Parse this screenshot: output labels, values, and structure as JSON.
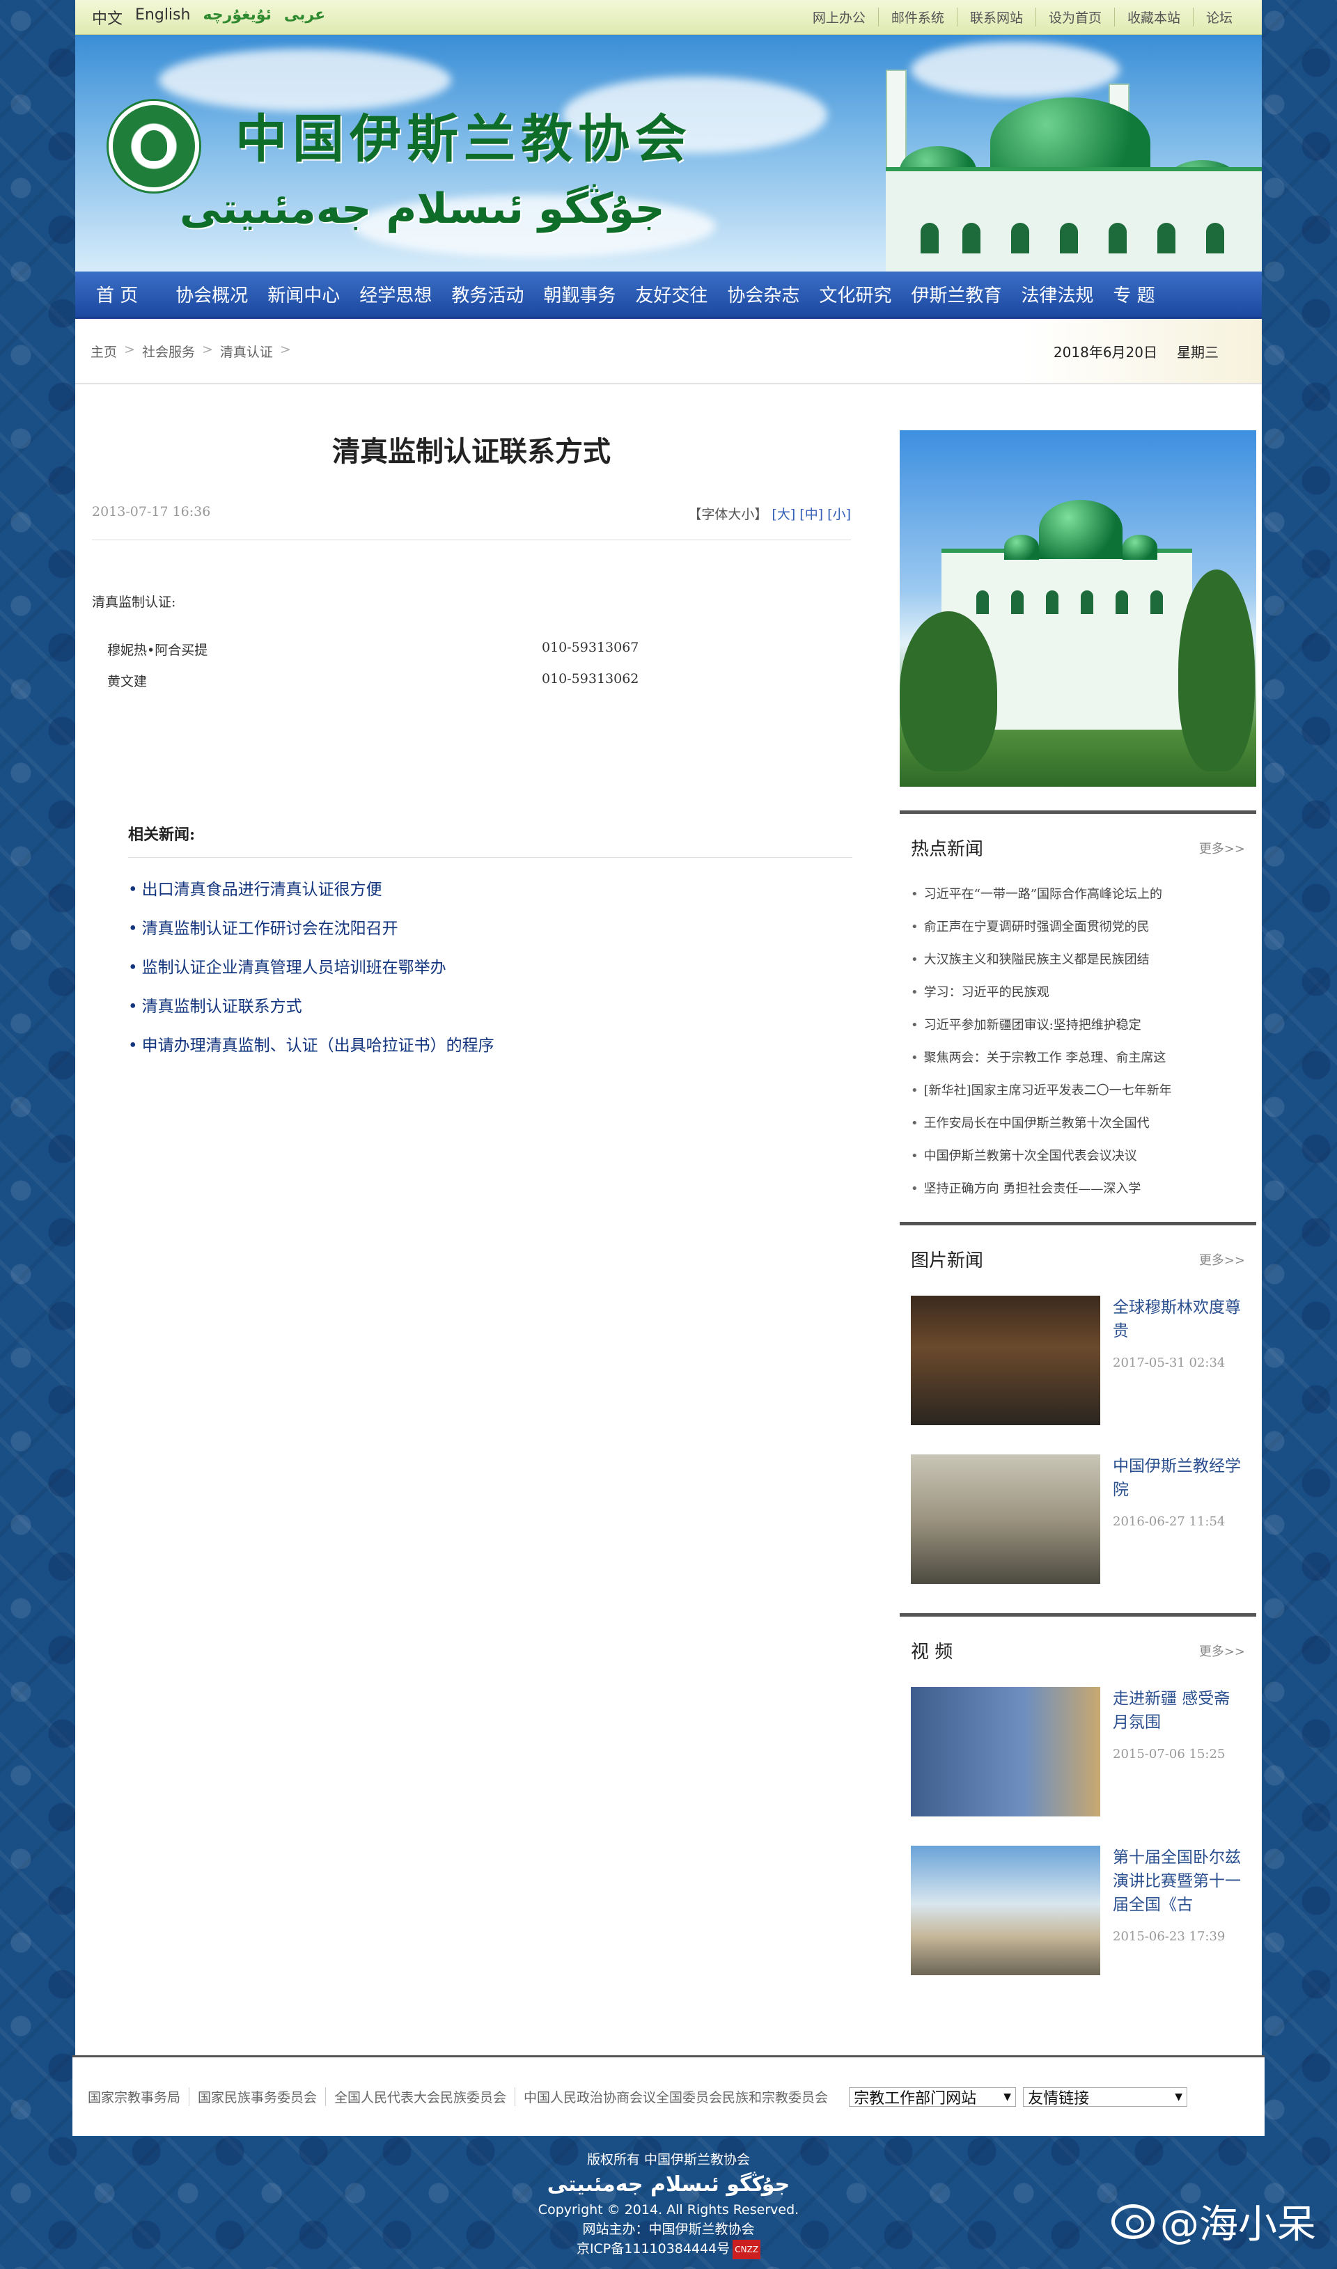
{
  "topbar": {
    "languages": [
      "中文",
      "English",
      "ئۇيغۇرچە",
      "عربی"
    ],
    "links": [
      "网上办公",
      "邮件系统",
      "联系网站",
      "设为首页",
      "收藏本站",
      "论坛"
    ]
  },
  "banner": {
    "site_name_zh": "中国伊斯兰教协会",
    "site_name_ug": "جۇڭگو ئىسلام جەمئىيتى"
  },
  "nav": {
    "items": [
      "首 页",
      "协会概况",
      "新闻中心",
      "经学思想",
      "教务活动",
      "朝觐事务",
      "友好交往",
      "协会杂志",
      "文化研究",
      "伊斯兰教育",
      "法律法规",
      "专 题"
    ]
  },
  "breadcrumb": {
    "items": [
      "主页",
      "社会服务",
      "清真认证"
    ],
    "date": "2018年6月20日",
    "weekday": "星期三"
  },
  "article": {
    "title": "清真监制认证联系方式",
    "datetime": "2013-07-17 16:36",
    "font_size_label": "【字体大小】",
    "font_sizes": [
      "[大]",
      "[中]",
      "[小]"
    ],
    "section_label": "清真监制认证:",
    "contacts": [
      {
        "name": "穆妮热•阿合买提",
        "phone": "010-59313067"
      },
      {
        "name": "黄文建",
        "phone": "010-59313062"
      }
    ]
  },
  "related": {
    "heading": "相关新闻:",
    "items": [
      "出口清真食品进行清真认证很方便",
      "清真监制认证工作研讨会在沈阳召开",
      "监制认证企业清真管理人员培训班在鄂举办",
      "清真监制认证联系方式",
      "申请办理清真监制、认证（出具哈拉证书）的程序"
    ]
  },
  "sidebar": {
    "hot": {
      "title": "热点新闻",
      "more": "更多>>",
      "items": [
        "习近平在“一带一路”国际合作高峰论坛上的",
        "俞正声在宁夏调研时强调全面贯彻党的民",
        "大汉族主义和狭隘民族主义都是民族团结",
        "学习：习近平的民族观",
        "习近平参加新疆团审议:坚持把维护稳定",
        "聚焦两会：关于宗教工作 李总理、俞主席这",
        "[新华社]国家主席习近平发表二〇一七年新年",
        "王作安局长在中国伊斯兰教第十次全国代",
        "中国伊斯兰教第十次全国代表会议决议",
        "坚持正确方向 勇担社会责任——深入学"
      ]
    },
    "photo": {
      "title": "图片新闻",
      "more": "更多>>",
      "items": [
        {
          "title": "全球穆斯林欢度尊贵",
          "date": "2017-05-31 02:34"
        },
        {
          "title": "中国伊斯兰教经学院",
          "date": "2016-06-27 11:54"
        }
      ]
    },
    "video": {
      "title": "视 频",
      "more": "更多>>",
      "items": [
        {
          "title": "走进新疆 感受斋月氛围",
          "date": "2015-07-06 15:25"
        },
        {
          "title": "第十届全国卧尔兹演讲比赛暨第十一届全国《古",
          "date": "2015-06-23 17:39"
        }
      ]
    }
  },
  "footer": {
    "links": [
      "国家宗教事务局",
      "国家民族事务委员会",
      "全国人民代表大会民族委员会",
      "中国人民政治协商会议全国委员会民族和宗教委员会"
    ],
    "select1": "宗教工作部门网站",
    "select2": "友情链接",
    "copyright_zh": "版权所有 中国伊斯兰教协会",
    "copyright_ug": "جۇڭگو ئىسلام جەمئىيتى",
    "copyright_en": "Copyright © 2014. All Rights Reserved.",
    "host": "网站主办：中国伊斯兰教协会",
    "icp": "京ICP备11110384444号",
    "cnzz": "CNZZ"
  },
  "watermark": {
    "text": "@海小呆"
  }
}
